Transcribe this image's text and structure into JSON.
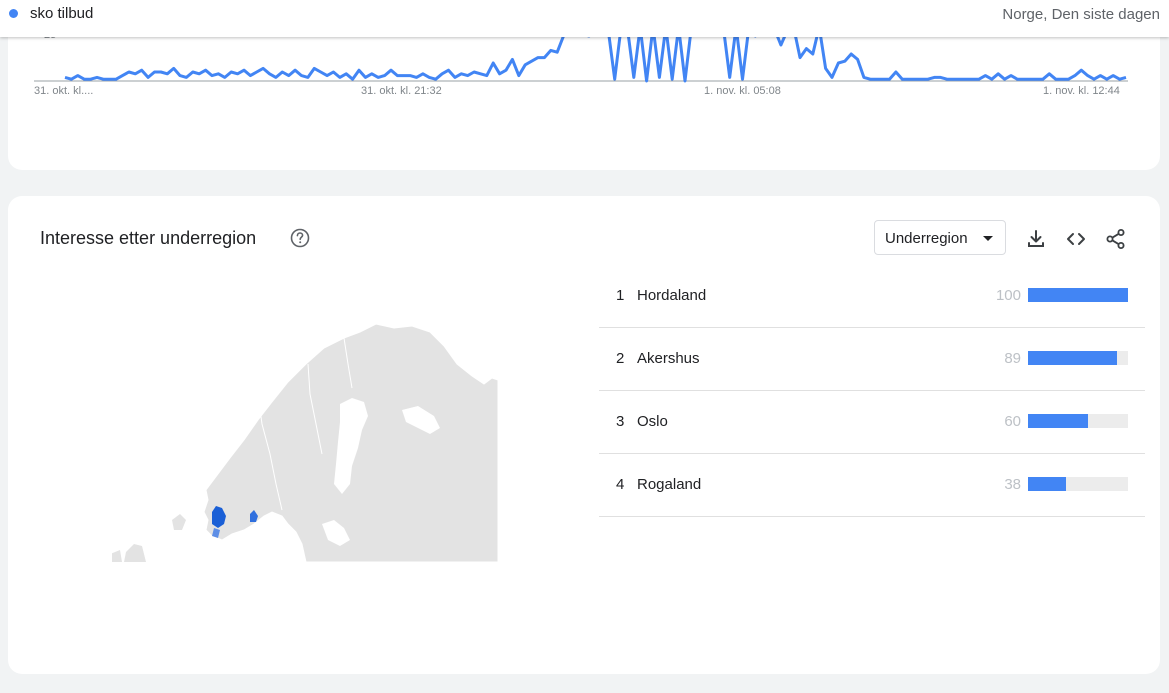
{
  "topbar": {
    "search_term": "sko tilbud",
    "term_color": "#4285f4",
    "geo_time": "Norge, Den siste dagen"
  },
  "timeline": {
    "y_tick_label": "25",
    "x_tick_labels": [
      "31. okt. kl....",
      "31. okt. kl. 21:32",
      "1. nov. kl. 05:08",
      "1. nov. kl. 12:44"
    ],
    "line_color": "#4285f4",
    "values": [
      2,
      1,
      3,
      1,
      1,
      2,
      1,
      1,
      1,
      3,
      5,
      4,
      6,
      2,
      5,
      5,
      4,
      7,
      3,
      2,
      5,
      4,
      6,
      3,
      4,
      2,
      5,
      4,
      6,
      3,
      5,
      7,
      4,
      2,
      5,
      3,
      6,
      3,
      2,
      7,
      5,
      3,
      5,
      2,
      4,
      1,
      6,
      2,
      4,
      2,
      3,
      6,
      3,
      3,
      3,
      2,
      4,
      2,
      1,
      4,
      6,
      2,
      4,
      3,
      5,
      4,
      3,
      10,
      4,
      6,
      12,
      3,
      9,
      11,
      13,
      13,
      17,
      16,
      25,
      30,
      27,
      26,
      25,
      28,
      27,
      28,
      1,
      30,
      29,
      2,
      30,
      0,
      30,
      2,
      30,
      1,
      30,
      0,
      30,
      28,
      30,
      29,
      30,
      30,
      2,
      30,
      1,
      30,
      25,
      28,
      30,
      29,
      20,
      28,
      30,
      13,
      18,
      15,
      30,
      7,
      2,
      10,
      11,
      15,
      12,
      2,
      1,
      1,
      1,
      1,
      5,
      1,
      1,
      1,
      1,
      1,
      2,
      2,
      1,
      1,
      1,
      1,
      1,
      1,
      3,
      1,
      4,
      1,
      3,
      1,
      1,
      1,
      1,
      1,
      4,
      1,
      1,
      1,
      3,
      6,
      3,
      1,
      3,
      1,
      3,
      1,
      2
    ],
    "y_max": 25
  },
  "subregion": {
    "title": "Interesse etter underregion",
    "help_icon": "help-icon",
    "dropdown_label": "Underregion",
    "tools": [
      "download-icon",
      "embed-icon",
      "share-icon"
    ],
    "accent": "#1a73e8",
    "rankings": [
      {
        "rank": "1",
        "name": "Hordaland",
        "value": "100",
        "score": 100
      },
      {
        "rank": "2",
        "name": "Akershus",
        "value": "89",
        "score": 89
      },
      {
        "rank": "3",
        "name": "Oslo",
        "value": "60",
        "score": 60
      },
      {
        "rank": "4",
        "name": "Rogaland",
        "value": "38",
        "score": 38
      }
    ]
  }
}
